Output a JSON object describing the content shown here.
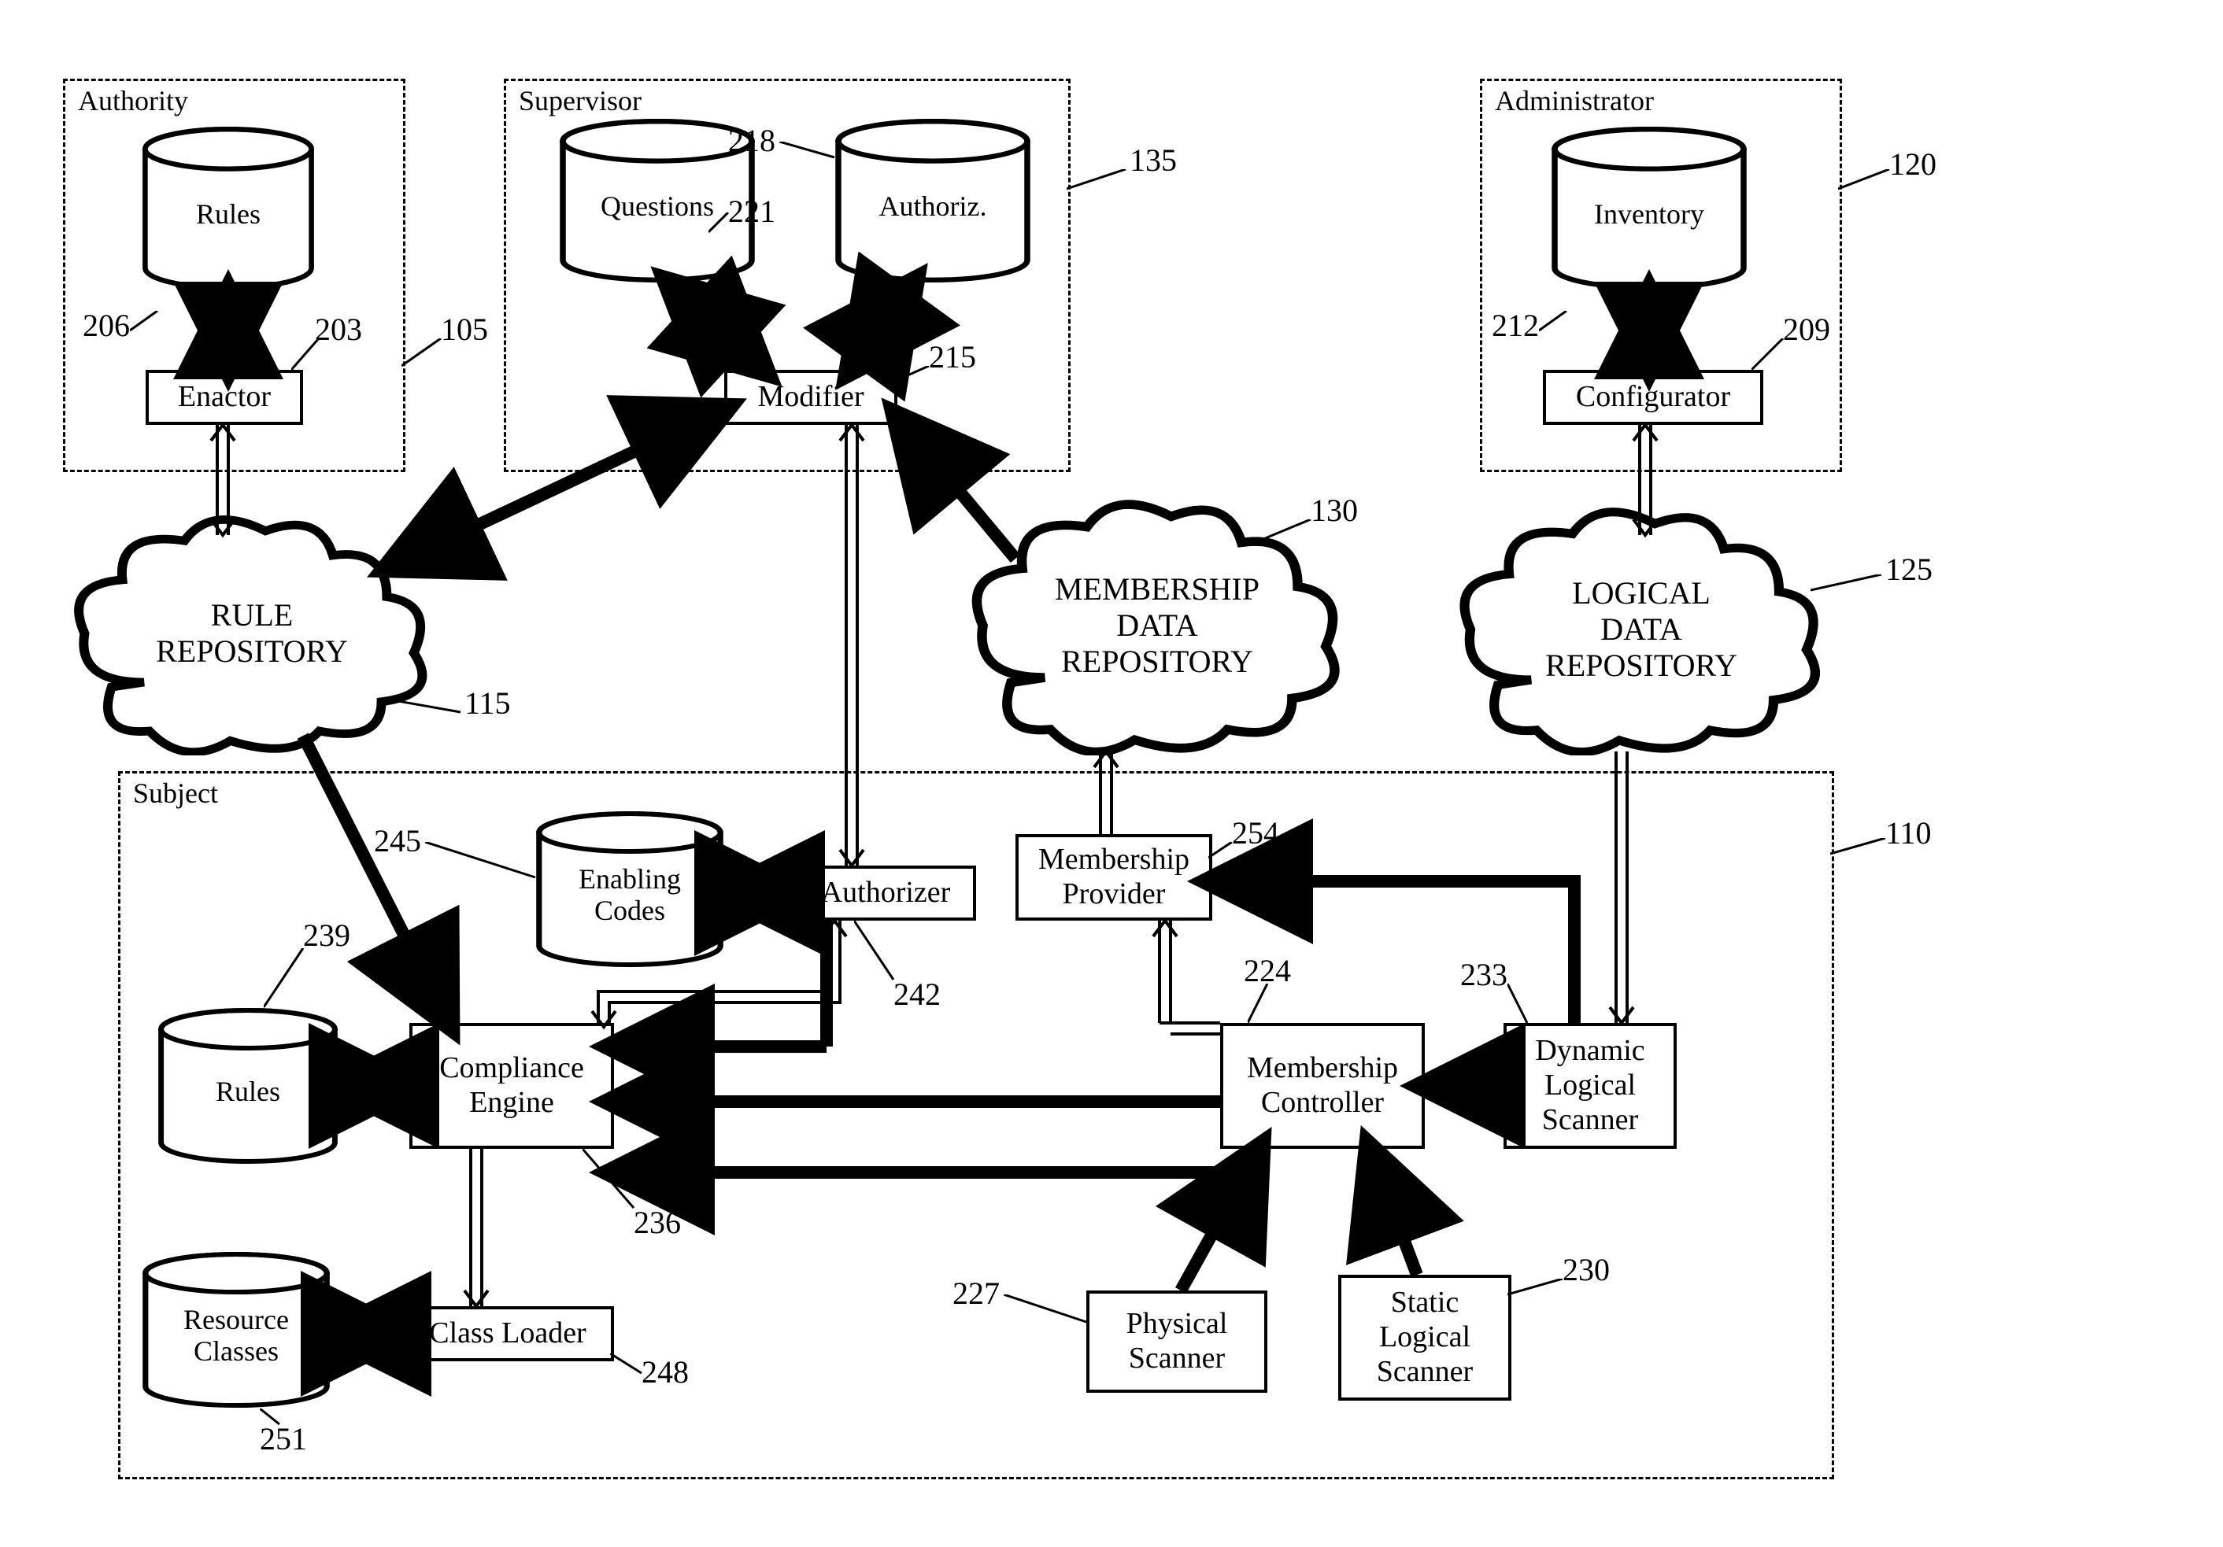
{
  "groups": {
    "authority": {
      "title": "Authority",
      "ref": "105"
    },
    "supervisor": {
      "title": "Supervisor",
      "ref": "135"
    },
    "administrator": {
      "title": "Administrator",
      "ref": "120"
    },
    "subject": {
      "title": "Subject",
      "ref": "110"
    }
  },
  "cylinders": {
    "rules1": {
      "label": "Rules",
      "ref": "206"
    },
    "questions": {
      "label": "Questions",
      "ref": "221"
    },
    "authoriz": {
      "label": "Authoriz.",
      "ref": "218"
    },
    "inventory": {
      "label": "Inventory",
      "ref": "212"
    },
    "enabling": {
      "label": "Enabling\nCodes",
      "ref": "245"
    },
    "rules2": {
      "label": "Rules",
      "ref": "239"
    },
    "resource": {
      "label": "Resource\nClasses",
      "ref": "251"
    }
  },
  "boxes": {
    "enactor": {
      "label": "Enactor",
      "ref": "203"
    },
    "modifier": {
      "label": "Modifier",
      "ref": "215"
    },
    "configurator": {
      "label": "Configurator",
      "ref": "209"
    },
    "authorizer": {
      "label": "Authorizer",
      "ref": "242"
    },
    "membership_provider": {
      "label": "Membership\nProvider",
      "ref": "254"
    },
    "compliance": {
      "label": "Compliance\nEngine",
      "ref": "236"
    },
    "membership_controller": {
      "label": "Membership\nController",
      "ref": "224"
    },
    "dynamic_scanner": {
      "label": "Dynamic\nLogical\nScanner",
      "ref": "233"
    },
    "class_loader": {
      "label": "Class Loader",
      "ref": "248"
    },
    "physical_scanner": {
      "label": "Physical\nScanner",
      "ref": "227"
    },
    "static_scanner": {
      "label": "Static\nLogical\nScanner",
      "ref": "230"
    }
  },
  "clouds": {
    "rule_repo": {
      "label": "RULE\nREPOSITORY",
      "ref": "115"
    },
    "membership_repo": {
      "label": "MEMBERSHIP\nDATA\nREPOSITORY",
      "ref": "130"
    },
    "logical_repo": {
      "label": "LOGICAL\nDATA\nREPOSITORY",
      "ref": "125"
    }
  },
  "chart_data": {
    "type": "diagram",
    "description": "System architecture block diagram with four dashed grouping boxes (Authority 105, Supervisor 135, Administrator 120, Subject 110), three cloud repositories (Rule Repository 115, Membership Data Repository 130, Logical Data Repository 125), cylinders for data stores, and rectangles for processing components, connected by thick solid arrows and thin double-line arrows.",
    "nodes": [
      {
        "id": "authority",
        "type": "group",
        "label": "Authority",
        "ref": 105
      },
      {
        "id": "supervisor",
        "type": "group",
        "label": "Supervisor",
        "ref": 135
      },
      {
        "id": "administrator",
        "type": "group",
        "label": "Administrator",
        "ref": 120
      },
      {
        "id": "subject",
        "type": "group",
        "label": "Subject",
        "ref": 110
      },
      {
        "id": "rules1",
        "type": "cylinder",
        "label": "Rules",
        "ref": 206,
        "parent": "authority"
      },
      {
        "id": "enactor",
        "type": "box",
        "label": "Enactor",
        "ref": 203,
        "parent": "authority"
      },
      {
        "id": "questions",
        "type": "cylinder",
        "label": "Questions",
        "ref": 221,
        "parent": "supervisor"
      },
      {
        "id": "authoriz",
        "type": "cylinder",
        "label": "Authoriz.",
        "ref": 218,
        "parent": "supervisor"
      },
      {
        "id": "modifier",
        "type": "box",
        "label": "Modifier",
        "ref": 215,
        "parent": "supervisor"
      },
      {
        "id": "inventory",
        "type": "cylinder",
        "label": "Inventory",
        "ref": 212,
        "parent": "administrator"
      },
      {
        "id": "configurator",
        "type": "box",
        "label": "Configurator",
        "ref": 209,
        "parent": "administrator"
      },
      {
        "id": "rule_repo",
        "type": "cloud",
        "label": "RULE REPOSITORY",
        "ref": 115
      },
      {
        "id": "membership_repo",
        "type": "cloud",
        "label": "MEMBERSHIP DATA REPOSITORY",
        "ref": 130
      },
      {
        "id": "logical_repo",
        "type": "cloud",
        "label": "LOGICAL DATA REPOSITORY",
        "ref": 125
      },
      {
        "id": "enabling",
        "type": "cylinder",
        "label": "Enabling Codes",
        "ref": 245,
        "parent": "subject"
      },
      {
        "id": "authorizer",
        "type": "box",
        "label": "Authorizer",
        "ref": 242,
        "parent": "subject"
      },
      {
        "id": "membership_provider",
        "type": "box",
        "label": "Membership Provider",
        "ref": 254,
        "parent": "subject"
      },
      {
        "id": "rules2",
        "type": "cylinder",
        "label": "Rules",
        "ref": 239,
        "parent": "subject"
      },
      {
        "id": "compliance",
        "type": "box",
        "label": "Compliance Engine",
        "ref": 236,
        "parent": "subject"
      },
      {
        "id": "membership_controller",
        "type": "box",
        "label": "Membership Controller",
        "ref": 224,
        "parent": "subject"
      },
      {
        "id": "dynamic_scanner",
        "type": "box",
        "label": "Dynamic Logical Scanner",
        "ref": 233,
        "parent": "subject"
      },
      {
        "id": "resource",
        "type": "cylinder",
        "label": "Resource Classes",
        "ref": 251,
        "parent": "subject"
      },
      {
        "id": "class_loader",
        "type": "box",
        "label": "Class Loader",
        "ref": 248,
        "parent": "subject"
      },
      {
        "id": "physical_scanner",
        "type": "box",
        "label": "Physical Scanner",
        "ref": 227,
        "parent": "subject"
      },
      {
        "id": "static_scanner",
        "type": "box",
        "label": "Static Logical Scanner",
        "ref": 230,
        "parent": "subject"
      }
    ],
    "edges": [
      {
        "from": "rules1",
        "to": "enactor",
        "style": "thick-bidir"
      },
      {
        "from": "enactor",
        "to": "rule_repo",
        "style": "double-bidir"
      },
      {
        "from": "questions",
        "to": "modifier",
        "style": "thick-bidir"
      },
      {
        "from": "authoriz",
        "to": "modifier",
        "style": "thick-bidir"
      },
      {
        "from": "modifier",
        "to": "rule_repo",
        "style": "thick-bidir"
      },
      {
        "from": "modifier",
        "to": "authorizer",
        "style": "double-bidir"
      },
      {
        "from": "membership_repo",
        "to": "modifier",
        "style": "thick-arrow"
      },
      {
        "from": "inventory",
        "to": "configurator",
        "style": "thick-bidir"
      },
      {
        "from": "configurator",
        "to": "logical_repo",
        "style": "double-bidir"
      },
      {
        "from": "logical_repo",
        "to": "dynamic_scanner",
        "style": "double-arrow"
      },
      {
        "from": "rule_repo",
        "to": "compliance",
        "style": "thick-arrow"
      },
      {
        "from": "enabling",
        "to": "authorizer",
        "style": "thick-bidir"
      },
      {
        "from": "authorizer",
        "to": "compliance",
        "style": "double-bidir"
      },
      {
        "from": "membership_provider",
        "to": "membership_repo",
        "style": "double-arrow"
      },
      {
        "from": "membership_controller",
        "to": "membership_provider",
        "style": "double-arrow"
      },
      {
        "from": "dynamic_scanner",
        "to": "membership_provider",
        "style": "thick-arrow"
      },
      {
        "from": "dynamic_scanner",
        "to": "membership_controller",
        "style": "thick-arrow"
      },
      {
        "from": "physical_scanner",
        "to": "membership_controller",
        "style": "thick-arrow"
      },
      {
        "from": "static_scanner",
        "to": "membership_controller",
        "style": "thick-arrow"
      },
      {
        "from": "membership_controller",
        "to": "compliance",
        "style": "thick-arrow"
      },
      {
        "from": "authorizer",
        "to": "compliance",
        "style": "thick-arrow"
      },
      {
        "from": "rules2",
        "to": "compliance",
        "style": "thick-bidir"
      },
      {
        "from": "resource",
        "to": "class_loader",
        "style": "thick-bidir"
      },
      {
        "from": "compliance",
        "to": "class_loader",
        "style": "double-arrow"
      }
    ]
  }
}
